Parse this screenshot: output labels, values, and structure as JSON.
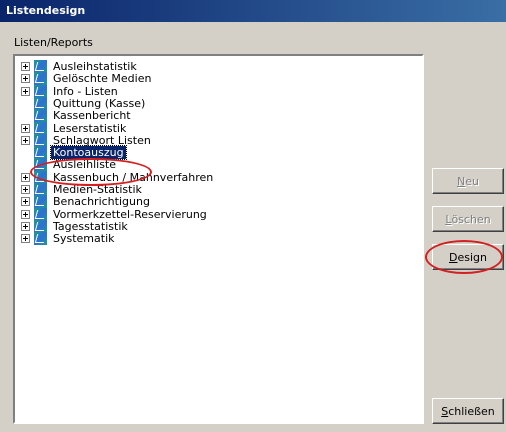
{
  "window": {
    "title": "Listendesign"
  },
  "group_label": "Listen/Reports",
  "tree": {
    "items": [
      {
        "label": "Ausleihstatistik",
        "expandable": true,
        "selected": false
      },
      {
        "label": "Gelöschte Medien",
        "expandable": true,
        "selected": false
      },
      {
        "label": "Info - Listen",
        "expandable": true,
        "selected": false
      },
      {
        "label": "Quittung (Kasse)",
        "expandable": false,
        "selected": false
      },
      {
        "label": "Kassenbericht",
        "expandable": false,
        "selected": false
      },
      {
        "label": "Leserstatistik",
        "expandable": true,
        "selected": false
      },
      {
        "label": "Schlagwort Listen",
        "expandable": true,
        "selected": false
      },
      {
        "label": "Kontoauszug",
        "expandable": false,
        "selected": true
      },
      {
        "label": "Ausleihliste",
        "expandable": false,
        "selected": false
      },
      {
        "label": "Kassenbuch / Mahnverfahren",
        "expandable": true,
        "selected": false
      },
      {
        "label": "Medien-Statistik",
        "expandable": true,
        "selected": false
      },
      {
        "label": "Benachrichtigung",
        "expandable": true,
        "selected": false
      },
      {
        "label": "Vormerkzettel-Reservierung",
        "expandable": true,
        "selected": false
      },
      {
        "label": "Tagesstatistik",
        "expandable": true,
        "selected": false
      },
      {
        "label": "Systematik",
        "expandable": true,
        "selected": false
      }
    ]
  },
  "buttons": {
    "neu": {
      "first": "N",
      "rest": "eu",
      "enabled": false
    },
    "loeschen": {
      "first": "L",
      "rest": "öschen",
      "enabled": false
    },
    "design": {
      "first": "D",
      "rest": "esign",
      "enabled": true
    },
    "schliessen": {
      "first": "S",
      "rest": "chließen",
      "enabled": true
    }
  },
  "annotation_color": "#d42020",
  "selection_color": "#0a246a"
}
